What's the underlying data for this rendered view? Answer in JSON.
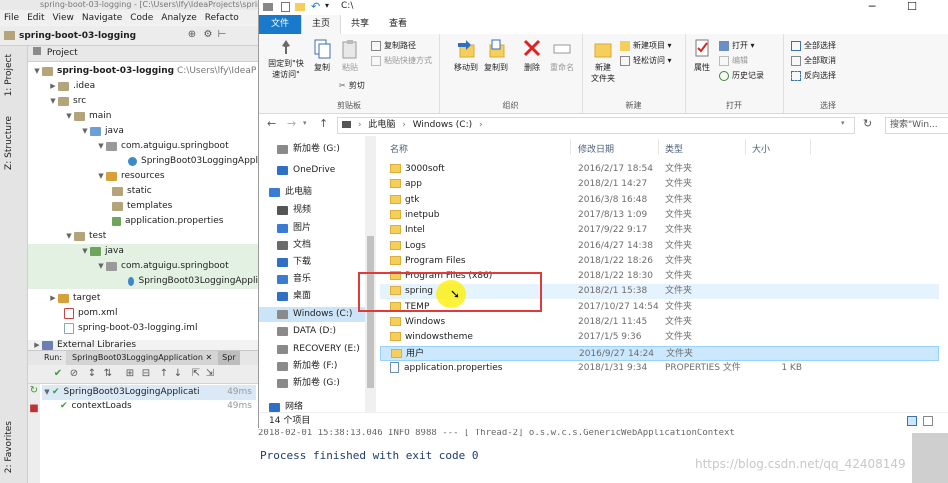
{
  "ide": {
    "title": "spring-boot-03-logging - [C:\\Users\\lfy\\IdeaProjects\\spring-boot-03-logging]",
    "menu": [
      "File",
      "Edit",
      "View",
      "Navigate",
      "Code",
      "Analyze",
      "Refacto"
    ],
    "project_name": "spring-boot-03-logging",
    "side_tabs": {
      "project": "1: Project",
      "structure": "Z: Structure",
      "favorites": "2: Favorites"
    },
    "project_header": "Project",
    "tree": {
      "root_name": "spring-boot-03-logging",
      "root_path": "C:\\Users\\lfy\\IdeaP",
      "idea": ".idea",
      "src": "src",
      "main": "main",
      "java": "java",
      "pkg": "com.atguigu.springboot",
      "main_class": "SpringBoot03LoggingAppli",
      "resources": "resources",
      "static": "static",
      "templates": "templates",
      "app_props": "application.properties",
      "test": "test",
      "test_java": "java",
      "test_pkg": "com.atguigu.springboot",
      "test_class": "SpringBoot03LoggingAppli",
      "target": "target",
      "pom": "pom.xml",
      "iml": "spring-boot-03-logging.iml",
      "ext_libs": "External Libraries"
    },
    "run": {
      "label": "Run:",
      "tab1": "SpringBoot03LoggingApplication",
      "tab2": "Spr",
      "test_root": "SpringBoot03LoggingApplicati",
      "test_root_time": "49ms",
      "test_child": "contextLoads",
      "test_child_time": "49ms"
    },
    "console": {
      "partial_line": "2018-02-01 15:38:13.046  INFO 8988 --- [       Thread-2] o.s.w.c.s.GenericWebApplicationContext",
      "finished": "Process finished with exit code 0"
    },
    "watermark": "https://blog.csdn.net/qq_42408149"
  },
  "explorer": {
    "title_path": "C:\\",
    "ribbon_tabs": [
      "文件",
      "主页",
      "共享",
      "查看"
    ],
    "clipboard": {
      "pin": "固定到\"快\n速访问\"",
      "copy": "复制",
      "paste": "粘贴",
      "copy_path": "复制路径",
      "paste_shortcut": "粘贴快捷方式",
      "cut": "剪切",
      "label": "剪贴板"
    },
    "organize": {
      "move_to": "移动到",
      "copy_to": "复制到",
      "delete": "删除",
      "rename": "重命名",
      "label": "组织"
    },
    "new": {
      "new_folder": "新建\n文件夹",
      "new_item": "新建项目 ▾",
      "easy_access": "轻松访问 ▾",
      "label": "新建"
    },
    "open": {
      "properties": "属性",
      "open": "打开 ▾",
      "edit": "编辑",
      "history": "历史记录",
      "label": "打开"
    },
    "select": {
      "all": "全部选择",
      "none": "全部取消",
      "invert": "反向选择",
      "label": "选择"
    },
    "address": {
      "this_pc": "此电脑",
      "drive": "Windows (C:)"
    },
    "search_placeholder": "搜索\"Win...",
    "nav_items": [
      {
        "label": "新加卷 (G:)",
        "kind": "drive"
      },
      {
        "label": "OneDrive",
        "kind": "cloud"
      },
      {
        "label": "此电脑",
        "kind": "pc"
      },
      {
        "label": "视频",
        "kind": "video"
      },
      {
        "label": "图片",
        "kind": "picture"
      },
      {
        "label": "文档",
        "kind": "doc"
      },
      {
        "label": "下载",
        "kind": "download"
      },
      {
        "label": "音乐",
        "kind": "music"
      },
      {
        "label": "桌面",
        "kind": "desktop"
      },
      {
        "label": "Windows (C:)",
        "kind": "drive"
      },
      {
        "label": "DATA (D:)",
        "kind": "drive"
      },
      {
        "label": "RECOVERY (E:)",
        "kind": "drive"
      },
      {
        "label": "新加卷 (F:)",
        "kind": "drive"
      },
      {
        "label": "新加卷 (G:)",
        "kind": "drive"
      },
      {
        "label": "网络",
        "kind": "network"
      }
    ],
    "columns": {
      "name": "名称",
      "modified": "修改日期",
      "type": "类型",
      "size": "大小"
    },
    "files": [
      {
        "name": "3000soft",
        "modified": "2016/2/17 18:54",
        "type": "文件夹",
        "size": ""
      },
      {
        "name": "app",
        "modified": "2018/2/1 14:27",
        "type": "文件夹",
        "size": ""
      },
      {
        "name": "gtk",
        "modified": "2016/3/8 16:48",
        "type": "文件夹",
        "size": ""
      },
      {
        "name": "inetpub",
        "modified": "2017/8/13 1:09",
        "type": "文件夹",
        "size": ""
      },
      {
        "name": "Intel",
        "modified": "2017/9/22 9:17",
        "type": "文件夹",
        "size": ""
      },
      {
        "name": "Logs",
        "modified": "2016/4/27 14:38",
        "type": "文件夹",
        "size": ""
      },
      {
        "name": "Program Files",
        "modified": "2018/1/22 18:26",
        "type": "文件夹",
        "size": ""
      },
      {
        "name": "Program Files (x86)",
        "modified": "2018/1/22 18:30",
        "type": "文件夹",
        "size": ""
      },
      {
        "name": "spring",
        "modified": "2018/2/1 15:38",
        "type": "文件夹",
        "size": ""
      },
      {
        "name": "TEMP",
        "modified": "2017/10/27 14:54",
        "type": "文件夹",
        "size": ""
      },
      {
        "name": "Windows",
        "modified": "2018/2/1 11:45",
        "type": "文件夹",
        "size": ""
      },
      {
        "name": "windowstheme",
        "modified": "2017/1/5 9:36",
        "type": "文件夹",
        "size": ""
      },
      {
        "name": "用户",
        "modified": "2016/9/27 14:24",
        "type": "文件夹",
        "size": ""
      },
      {
        "name": "application.properties",
        "modified": "2018/1/31 9:34",
        "type": "PROPERTIES 文件",
        "size": "1 KB"
      }
    ],
    "status": "14 个项目"
  }
}
